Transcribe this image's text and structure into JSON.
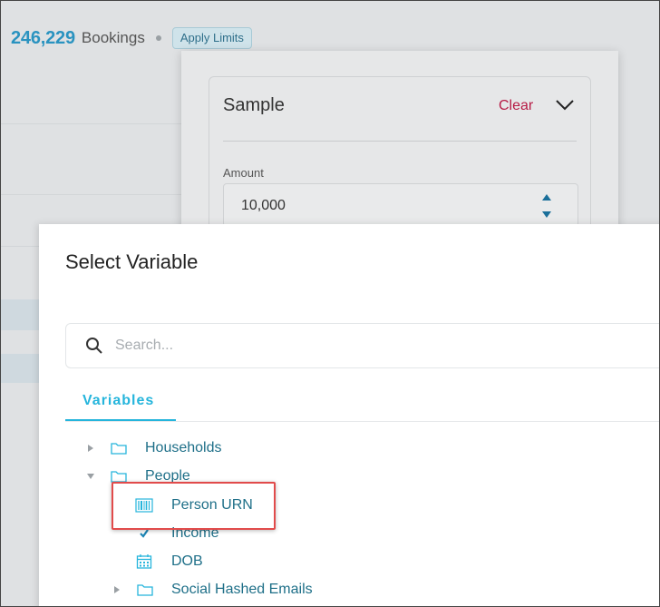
{
  "header": {
    "count": "246,229",
    "count_label": "Bookings",
    "apply_limits_label": "Apply Limits"
  },
  "sample_panel": {
    "title": "Sample",
    "clear_label": "Clear",
    "amount_label": "Amount",
    "amount_value": "10,000"
  },
  "modal": {
    "title": "Select Variable",
    "search_placeholder": "Search...",
    "tabs": [
      {
        "label": "Variables",
        "active": true
      }
    ],
    "tree": [
      {
        "label": "Households",
        "icon": "folder-icon",
        "expanded": false
      },
      {
        "label": "People",
        "icon": "folder-icon",
        "expanded": true,
        "children": [
          {
            "label": "Person URN",
            "icon": "barcode-icon",
            "highlighted": true
          },
          {
            "label": "Income",
            "icon": "check-icon"
          },
          {
            "label": "DOB",
            "icon": "calendar-icon"
          },
          {
            "label": "Social Hashed Emails",
            "icon": "folder-icon",
            "expanded": false
          }
        ]
      }
    ]
  },
  "colors": {
    "accent": "#25b5dc",
    "tree_text": "#1e6f88",
    "clear": "#b71c46",
    "highlight_border": "#e14b4b"
  }
}
